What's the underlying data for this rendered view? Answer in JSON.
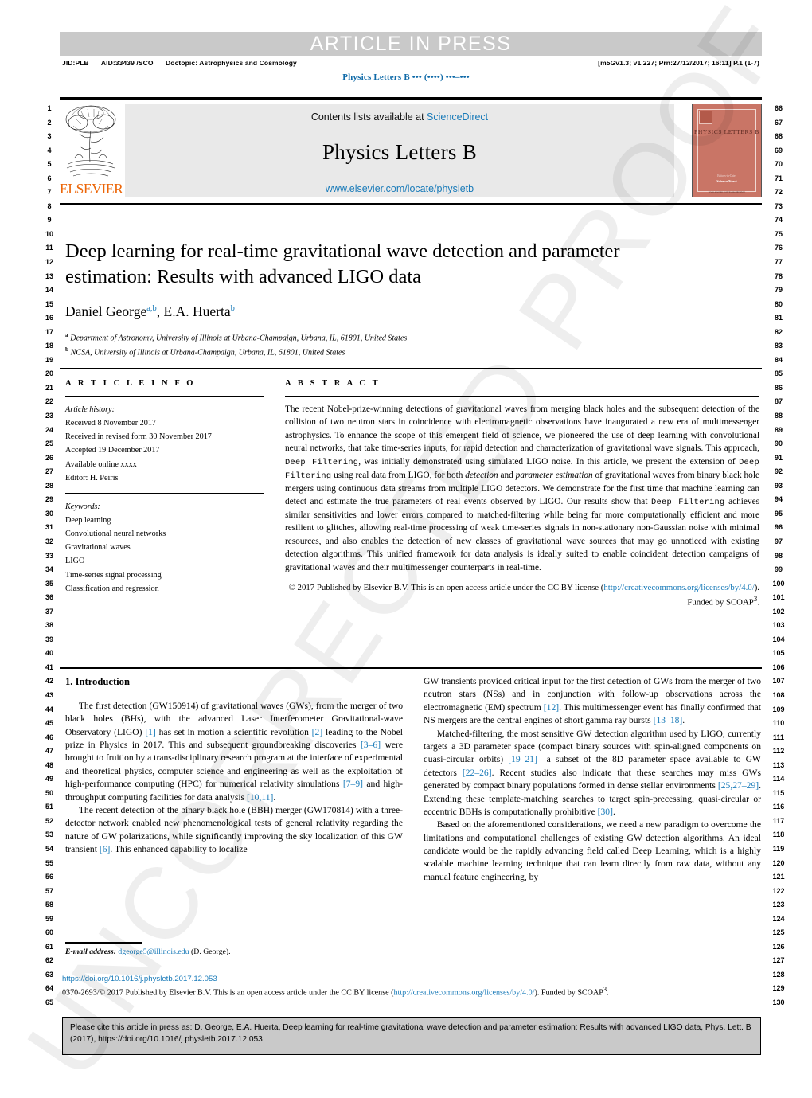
{
  "proof_banner": "ARTICLE IN PRESS",
  "proof_meta": {
    "jid": "JID:PLB",
    "aid": "AID:33439 /SCO",
    "doctopic": "Doctopic: Astrophysics and Cosmology",
    "right": "[m5Gv1.3; v1.227; Prn:27/12/2017; 16:11] P.1 (1-7)"
  },
  "journal_running_head": "Physics Letters B ••• (••••) •••–•••",
  "masthead": {
    "contents_prefix": "Contents lists available at ",
    "sciencedirect": "ScienceDirect",
    "journal_title": "Physics Letters B",
    "journal_url": "www.elsevier.com/locate/physletb",
    "publisher_logo_text": "ELSEVIER",
    "cover": {
      "title": "PHYSICS LETTERS B",
      "foot1": "Editors-in-Chief",
      "foot2": "ScienceDirect",
      "foot3": "www.elsevier.com/locate/physletb"
    }
  },
  "title": "Deep learning for real-time gravitational wave detection and parameter estimation: Results with advanced LIGO data",
  "authors": [
    {
      "name": "Daniel George",
      "marks": "a,b"
    },
    {
      "name": "E.A. Huerta",
      "marks": "b"
    }
  ],
  "affiliations": [
    {
      "mark": "a",
      "text": "Department of Astronomy, University of Illinois at Urbana-Champaign, Urbana, IL, 61801, United States"
    },
    {
      "mark": "b",
      "text": "NCSA, University of Illinois at Urbana-Champaign, Urbana, IL, 61801, United States"
    }
  ],
  "article_info": {
    "heading": "A R T I C L E    I N F O",
    "history_label": "Article history:",
    "history": [
      "Received 8 November 2017",
      "Received in revised form 30 November 2017",
      "Accepted 19 December 2017",
      "Available online xxxx",
      "Editor: H. Peiris"
    ],
    "keywords_label": "Keywords:",
    "keywords": [
      "Deep learning",
      "Convolutional neural networks",
      "Gravitational waves",
      "LIGO",
      "Time-series signal processing",
      "Classification and regression"
    ]
  },
  "abstract": {
    "heading": "A B S T R A C T",
    "part1": "The recent Nobel-prize-winning detections of gravitational waves from merging black holes and the subsequent detection of the collision of two neutron stars in coincidence with electromagnetic observations have inaugurated a new era of multimessenger astrophysics. To enhance the scope of this emergent field of science, we pioneered the use of deep learning with convolutional neural networks, that take time-series inputs, for rapid detection and characterization of gravitational wave signals. This approach, ",
    "mono1": "Deep Filtering",
    "part2": ", was initially demonstrated using simulated LIGO noise. In this article, we present the extension of ",
    "mono2": "Deep Filtering",
    "part3": " using real data from LIGO, for both ",
    "ital1": "detection",
    "part4": " and ",
    "ital2": "parameter estimation",
    "part5": " of gravitational waves from binary black hole mergers using continuous data streams from multiple LIGO detectors. We demonstrate for the first time that machine learning can detect and estimate the true parameters of real events observed by LIGO. Our results show that ",
    "mono3": "Deep Filtering",
    "part6": " achieves similar sensitivities and lower errors compared to matched-filtering while being far more computationally efficient and more resilient to glitches, allowing real-time processing of weak time-series signals in non-stationary non-Gaussian noise with minimal resources, and also enables the detection of new classes of gravitational wave sources that may go unnoticed with existing detection algorithms. This unified framework for data analysis is ideally suited to enable coincident detection campaigns of gravitational waves and their multimessenger counterparts in real-time.",
    "copyright_pre": "© 2017 Published by Elsevier B.V. This is an open access article under the CC BY license (",
    "copyright_link": "http://creativecommons.org/licenses/by/4.0/",
    "copyright_post": "). Funded by SCOAP",
    "copyright_sup": "3",
    "copyright_end": "."
  },
  "body": {
    "section_heading": "1. Introduction",
    "left_paragraphs": [
      {
        "runs": [
          {
            "t": "The first detection (GW150914) of gravitational waves (GWs), from the merger of two black holes (BHs), with the advanced Laser Interferometer Gravitational-wave Observatory (LIGO) "
          },
          {
            "t": "[1]",
            "ref": true
          },
          {
            "t": " has set in motion a scientific revolution "
          },
          {
            "t": "[2]",
            "ref": true
          },
          {
            "t": " leading to the Nobel prize in Physics in 2017. This and subsequent groundbreaking discoveries "
          },
          {
            "t": "[3–6]",
            "ref": true
          },
          {
            "t": " were brought to fruition by a trans-disciplinary research program at the interface of experimental and theoretical physics, computer science and engineering as well as the exploitation of high-performance computing (HPC) for numerical relativity simulations "
          },
          {
            "t": "[7–9]",
            "ref": true
          },
          {
            "t": " and high-throughput computing facilities for data analysis "
          },
          {
            "t": "[10,11]",
            "ref": true
          },
          {
            "t": "."
          }
        ]
      },
      {
        "runs": [
          {
            "t": "The recent detection of the binary black hole (BBH) merger (GW170814) with a three-detector network enabled new phenomenological tests of general relativity regarding the nature of GW polarizations, while significantly improving the sky localization of this GW transient "
          },
          {
            "t": "[6]",
            "ref": true
          },
          {
            "t": ". This enhanced capability to localize"
          }
        ]
      }
    ],
    "right_paragraphs": [
      {
        "no_indent": true,
        "runs": [
          {
            "t": "GW transients provided critical input for the first detection of GWs from the merger of two neutron stars (NSs) and in conjunction with follow-up observations across the electromagnetic (EM) spectrum "
          },
          {
            "t": "[12]",
            "ref": true
          },
          {
            "t": ". This multimessenger event has finally confirmed that NS mergers are the central engines of short gamma ray bursts "
          },
          {
            "t": "[13–18]",
            "ref": true
          },
          {
            "t": "."
          }
        ]
      },
      {
        "runs": [
          {
            "t": "Matched-filtering, the most sensitive GW detection algorithm used by LIGO, currently targets a 3D parameter space (compact binary sources with spin-aligned components on quasi-circular orbits) "
          },
          {
            "t": "[19–21]",
            "ref": true
          },
          {
            "t": "—a subset of the 8D parameter space available to GW detectors "
          },
          {
            "t": "[22–26]",
            "ref": true
          },
          {
            "t": ". Recent studies also indicate that these searches may miss GWs generated by compact binary populations formed in dense stellar environments "
          },
          {
            "t": "[25,27–29]",
            "ref": true
          },
          {
            "t": ". Extending these template-matching searches to target spin-precessing, quasi-circular or eccentric BBHs is computationally prohibitive "
          },
          {
            "t": "[30]",
            "ref": true
          },
          {
            "t": "."
          }
        ]
      },
      {
        "runs": [
          {
            "t": "Based on the aforementioned considerations, we need a new paradigm to overcome the limitations and computational challenges of existing GW detection algorithms. An ideal candidate would be the rapidly advancing field called Deep Learning, which is a highly scalable machine learning technique that can learn directly from raw data, without any manual feature engineering, by"
          }
        ]
      }
    ]
  },
  "footnote": {
    "label": "E-mail address:",
    "email": "dgeorge5@illinois.edu",
    "suffix": " (D. George)."
  },
  "bottom": {
    "doi": "https://doi.org/10.1016/j.physletb.2017.12.053",
    "issn_pre": "0370-2693/© 2017 Published by Elsevier B.V. This is an open access article under the CC BY license (",
    "issn_link": "http://creativecommons.org/licenses/by/4.0/",
    "issn_post": "). Funded by SCOAP",
    "issn_sup": "3",
    "issn_end": "."
  },
  "cite_box": "Please cite this article in press as: D. George, E.A. Huerta, Deep learning for real-time gravitational wave detection and parameter estimation: Results with advanced LIGO data, Phys. Lett. B (2017), https://doi.org/10.1016/j.physletb.2017.12.053",
  "watermark": "UNCORRECTED PROOF",
  "line_numbers": {
    "left_start": 1,
    "left_end": 65,
    "right_start": 66,
    "right_end": 130
  },
  "colors": {
    "link": "#1a7bb9",
    "elsevier_orange": "#ec6608",
    "banner_gray": "#c9c9c9",
    "masthead_gray": "#e9e9e9",
    "cover_red": "#c97566"
  }
}
